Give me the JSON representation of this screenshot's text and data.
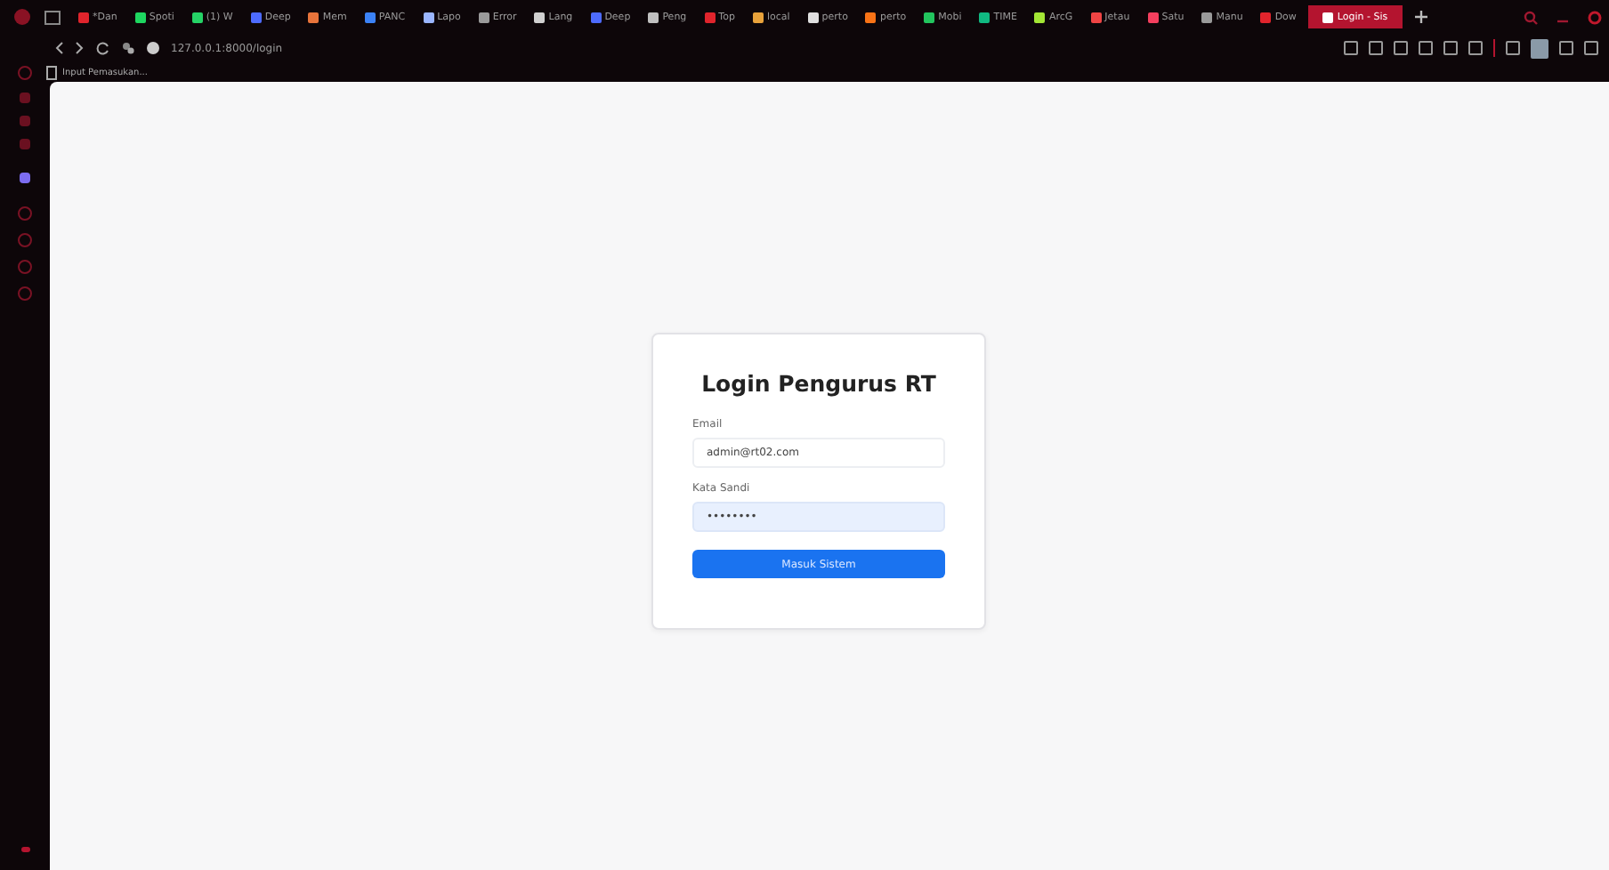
{
  "browser": {
    "tabs": [
      {
        "label": "*Dan",
        "selected": false,
        "color": "#e0242c"
      },
      {
        "label": "Spoti",
        "selected": false,
        "color": "#1ed760"
      },
      {
        "label": "(1) W",
        "selected": false,
        "color": "#25d366"
      },
      {
        "label": "Deep",
        "selected": false,
        "color": "#4d6bfe"
      },
      {
        "label": "Mem",
        "selected": false,
        "color": "#e8743b"
      },
      {
        "label": "PANC",
        "selected": false,
        "color": "#3b82f6"
      },
      {
        "label": "Lapo",
        "selected": false,
        "color": "#9ab6ff"
      },
      {
        "label": "Error",
        "selected": false,
        "color": "#9a9a9a"
      },
      {
        "label": "Lang",
        "selected": false,
        "color": "#d0d0d0"
      },
      {
        "label": "Deep",
        "selected": false,
        "color": "#4d6bfe"
      },
      {
        "label": "Peng",
        "selected": false,
        "color": "#c0c0c0"
      },
      {
        "label": "Top",
        "selected": false,
        "color": "#e0242c"
      },
      {
        "label": "local",
        "selected": false,
        "color": "#e8a23b"
      },
      {
        "label": "perto",
        "selected": false,
        "color": "#e0e0e0"
      },
      {
        "label": "perto",
        "selected": false,
        "color": "#f97316"
      },
      {
        "label": "Mobi",
        "selected": false,
        "color": "#22c55e"
      },
      {
        "label": "TIME",
        "selected": false,
        "color": "#10b981"
      },
      {
        "label": "ArcG",
        "selected": false,
        "color": "#a3e635"
      },
      {
        "label": "Jetau",
        "selected": false,
        "color": "#ef4444"
      },
      {
        "label": "Satu",
        "selected": false,
        "color": "#f43f5e"
      },
      {
        "label": "Manu",
        "selected": false,
        "color": "#9a9a9a"
      },
      {
        "label": "Dow",
        "selected": false,
        "color": "#e0242c"
      },
      {
        "label": "Login - Sis",
        "selected": true,
        "color": "#ffffff"
      }
    ],
    "url": "127.0.0.1:8000/login",
    "bookmark": "Input Pemasukan..."
  },
  "login": {
    "title": "Login Pengurus RT",
    "fields": [
      {
        "label": "Email",
        "value": "admin@rt02.com",
        "focused": false
      },
      {
        "label": "Kata Sandi",
        "value": "••••••••",
        "focused": true
      }
    ],
    "submit": "Masuk Sistem"
  }
}
